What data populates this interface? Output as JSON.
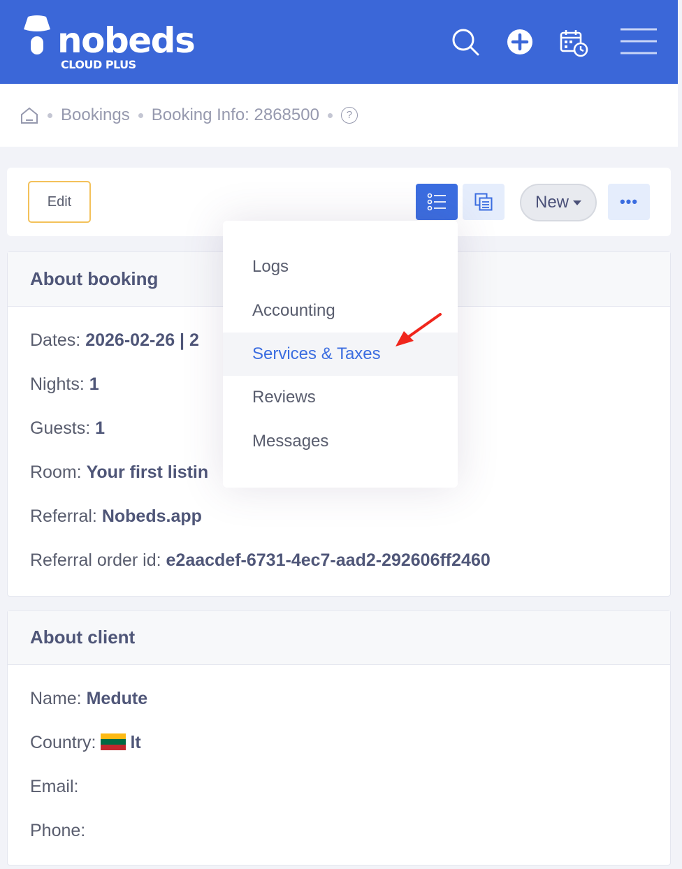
{
  "brand": {
    "name": "nobeds",
    "sub": "CLOUD PLUS",
    "color": "#3b67d8"
  },
  "header_icons": [
    "search-icon",
    "add-circle-icon",
    "calendar-clock-icon",
    "hamburger-menu-icon"
  ],
  "breadcrumb": {
    "home_icon": "home-icon",
    "items": [
      "Bookings",
      "Booking Info: 2868500"
    ],
    "help": "?"
  },
  "toolbar": {
    "edit_label": "Edit",
    "new_label": "New",
    "more_label": "•••"
  },
  "dropdown": {
    "items": [
      "Logs",
      "Accounting",
      "Services & Taxes",
      "Reviews",
      "Messages"
    ],
    "active_index": 2
  },
  "about_booking": {
    "title": "About booking",
    "dates_label": "Dates:",
    "dates_value": "2026-02-26 | 2",
    "nights_label": "Nights:",
    "nights_value": "1",
    "guests_label": "Guests:",
    "guests_value": "1",
    "room_label": "Room:",
    "room_value": "Your first listin",
    "referral_label": "Referral:",
    "referral_value": "Nobeds.app",
    "order_label": "Referral order id:",
    "order_value": "e2aacdef-6731-4ec7-aad2-292606ff2460"
  },
  "about_client": {
    "title": "About client",
    "name_label": "Name:",
    "name_value": "Medute",
    "country_label": "Country:",
    "country_value": "lt",
    "email_label": "Email:",
    "phone_label": "Phone:"
  },
  "colors": {
    "accent": "#3b6de0",
    "edit_border": "#f3c15a",
    "annotation_arrow": "#f0261c"
  }
}
